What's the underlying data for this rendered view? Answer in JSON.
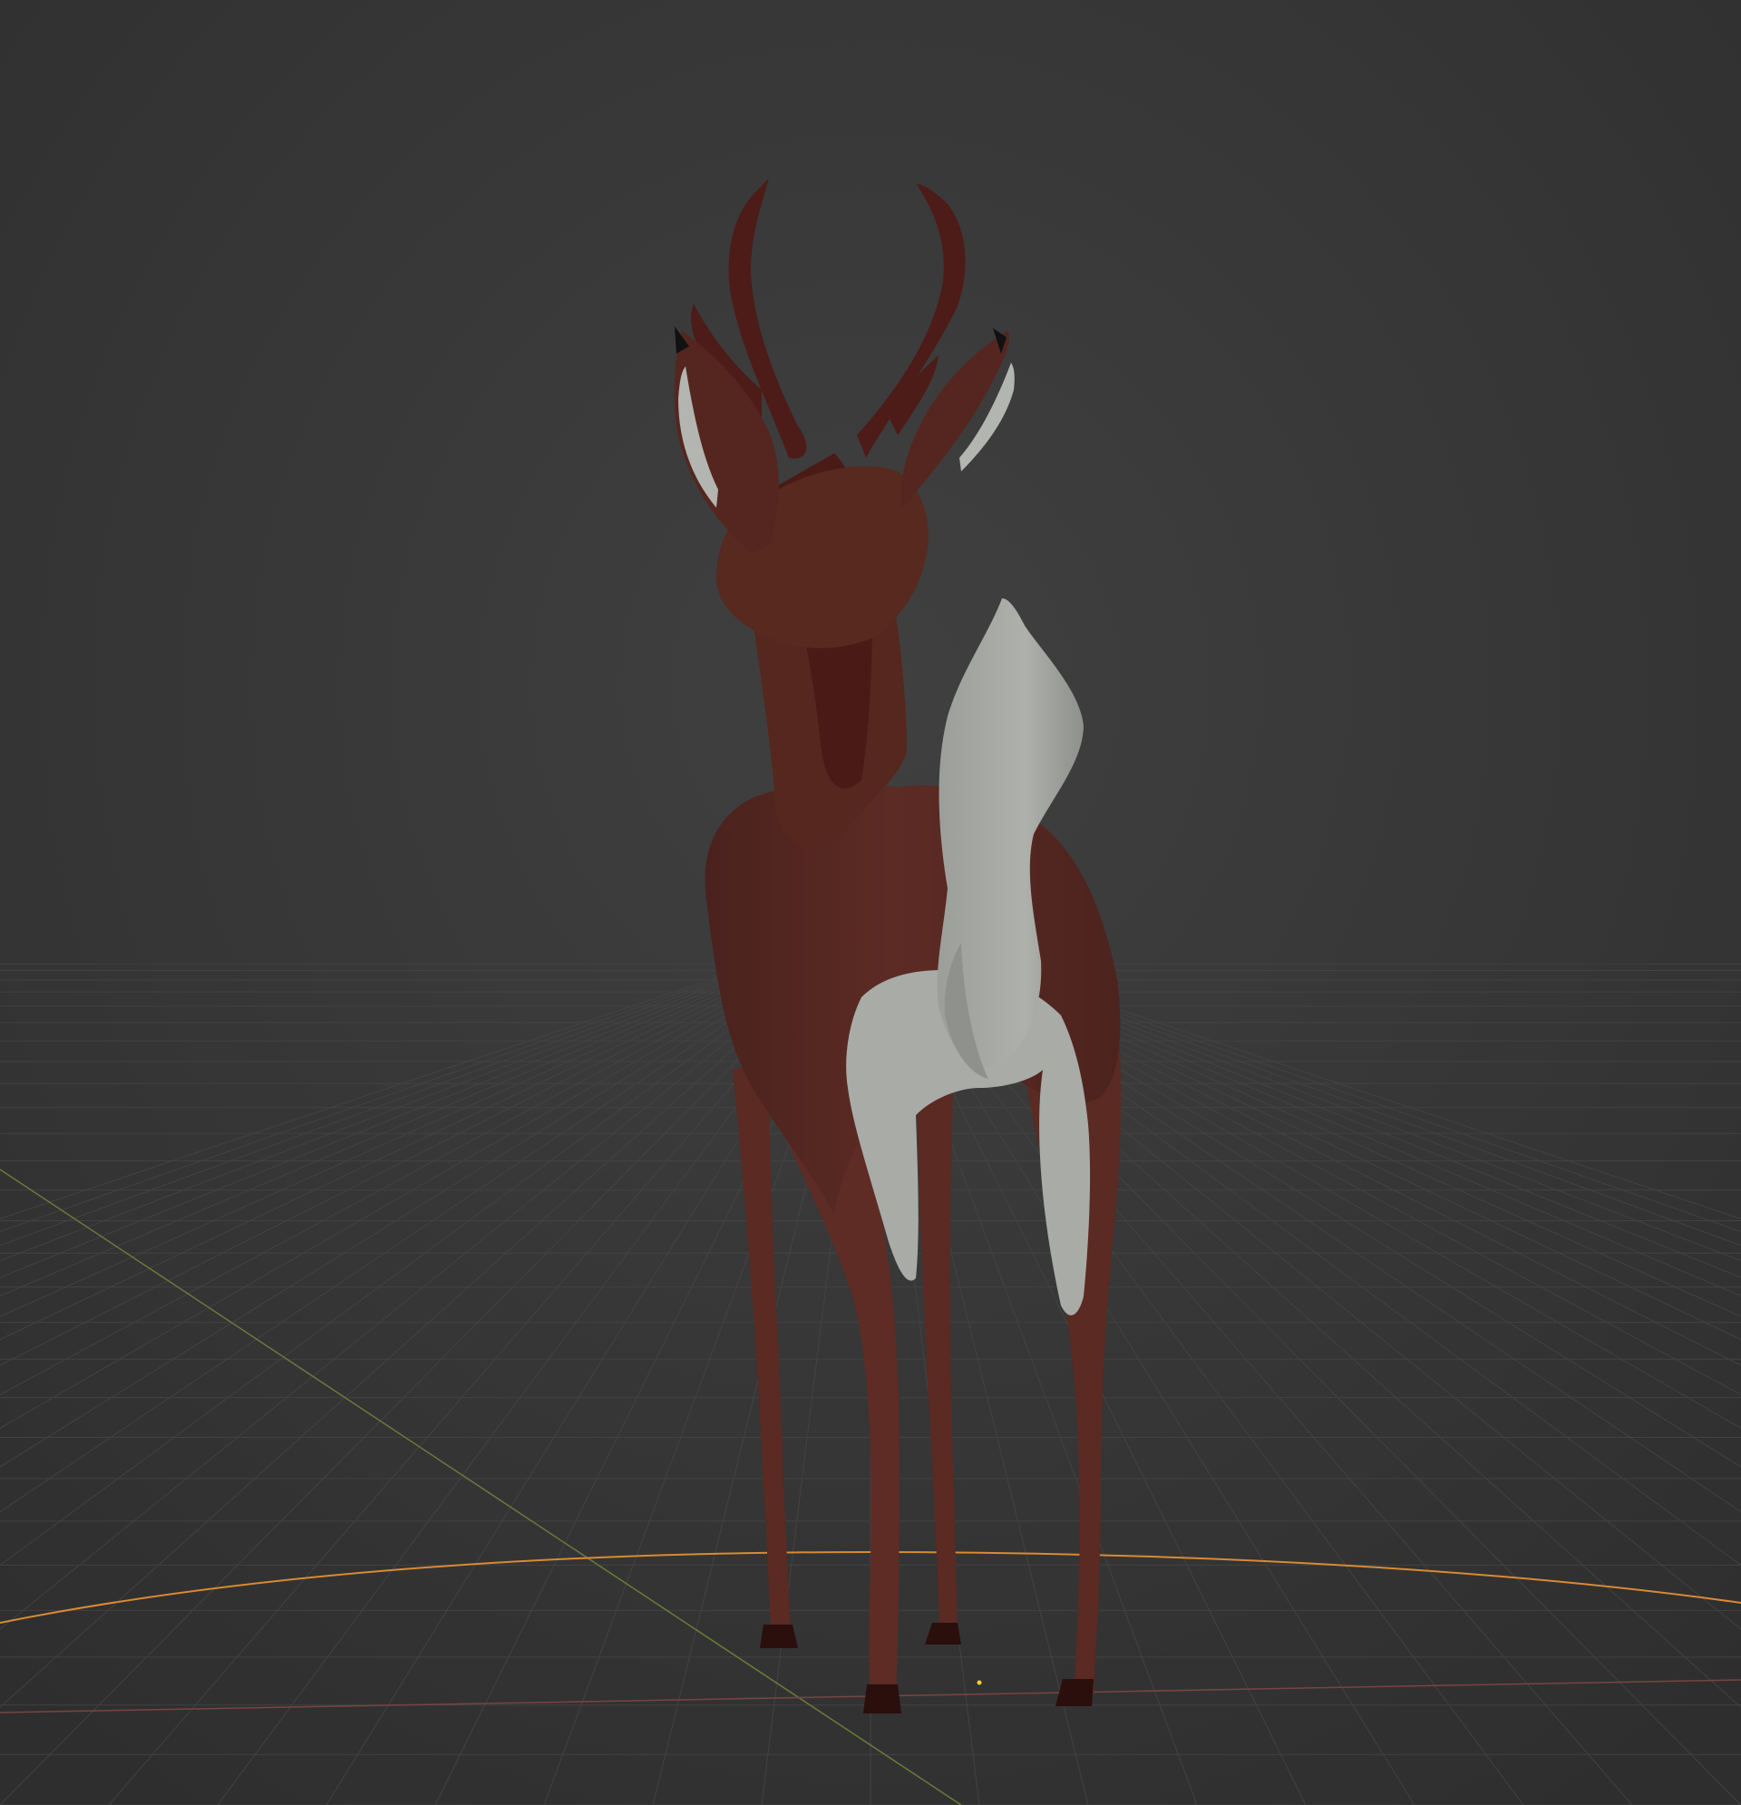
{
  "viewport": {
    "kind": "3d-viewport",
    "background_color": "#3a3a3a",
    "vignette_color": "#2e2e2e",
    "grid_color": "#454545",
    "x_axis_color": "#8a4b4b",
    "y_axis_color": "#6b7a3c",
    "selection_outline_color": "#e5973a",
    "cursor_3d_color": "#ffcc33"
  },
  "model": {
    "subject": "deer",
    "body_color": "#5c2b24",
    "body_shadow_color": "#4a211c",
    "dark_fur_color": "#4d1c18",
    "white_fur_color": "#a8aaa6",
    "white_shadow_color": "#8f918d",
    "hoof_color": "#2a0f0d",
    "ear_tip_color": "#111111"
  }
}
